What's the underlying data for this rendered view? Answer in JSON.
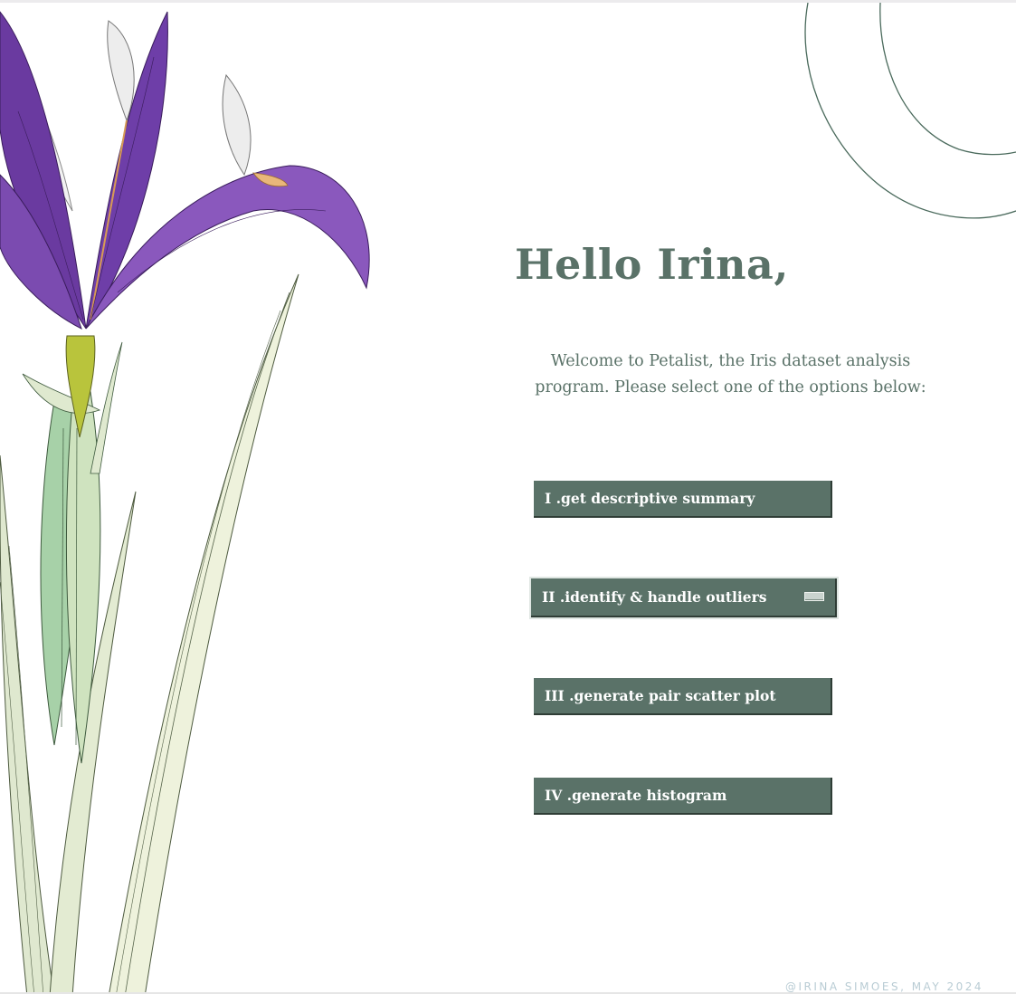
{
  "greeting": "Hello Irina,",
  "intro_line_1": "Welcome to Petalist, the Iris dataset analysis",
  "intro_line_2": "program. Please select one of the options below:",
  "menu": {
    "options": [
      {
        "label": "I .get descriptive summary"
      },
      {
        "label": "II .identify & handle outliers"
      },
      {
        "label": "III .generate pair scatter plot"
      },
      {
        "label": "IV .generate histogram"
      }
    ]
  },
  "credit": "@IRINA SIMOES, MAY 2024",
  "colors": {
    "accent": "#5a7268",
    "button_text": "#ffffff",
    "petal": "#7b4bb0",
    "leaf": "#c9d9b8",
    "credit": "#b9ccd4"
  },
  "icons": [
    "iris-flower-illustration",
    "corner-swirl-decoration"
  ]
}
